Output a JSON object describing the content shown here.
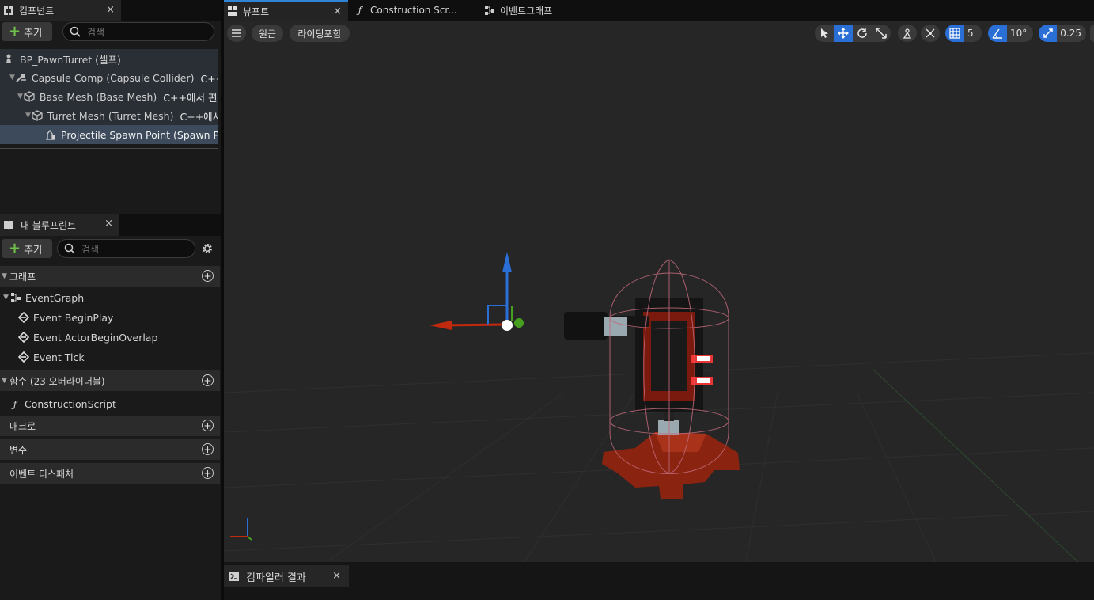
{
  "components_panel": {
    "tab_title": "컴포넌트",
    "close": "×",
    "add_label": "추가",
    "search_placeholder": "검색",
    "tree": [
      {
        "label": "BP_PawnTurret (셀프)",
        "suffix": ""
      },
      {
        "label": "Capsule Comp (Capsule Collider)",
        "suffix": "C++에서 편집 가능"
      },
      {
        "label": "Base Mesh (Base Mesh)",
        "suffix": "C++에서 편집 가능"
      },
      {
        "label": "Turret Mesh (Turret Mesh)",
        "suffix": "C++에서 편집 가능"
      },
      {
        "label": "Projectile Spawn Point (Spawn Point)",
        "suffix": ""
      }
    ]
  },
  "blueprint_panel": {
    "tab_title": "내 블루프린트",
    "close": "×",
    "add_label": "추가",
    "search_placeholder": "검색",
    "sections": {
      "graphs": "그래프",
      "functions": "함수 (23 오버라이더블)",
      "macros": "매크로",
      "variables": "변수",
      "dispatchers": "이벤트 디스패처"
    },
    "event_graph": "EventGraph",
    "events": [
      "Event BeginPlay",
      "Event ActorBeginOverlap",
      "Event Tick"
    ],
    "function": "ConstructionScript"
  },
  "editor_tabs": [
    {
      "label": "뷰포트",
      "close": "×"
    },
    {
      "label": "Construction Scr..."
    },
    {
      "label": "이벤트그래프"
    }
  ],
  "viewport_toolbar": {
    "view_mode": "원근",
    "lighting": "라이팅포함",
    "grid_snap": "5",
    "rotation_snap": "10°",
    "scale_snap": "0.25"
  },
  "bottom_panel": {
    "tab_title": "컴파일러 결과",
    "close": "×"
  },
  "colors": {
    "accent": "#2a6fd6",
    "selection": "#3c4a5c",
    "add_plus": "#6fc14a"
  }
}
